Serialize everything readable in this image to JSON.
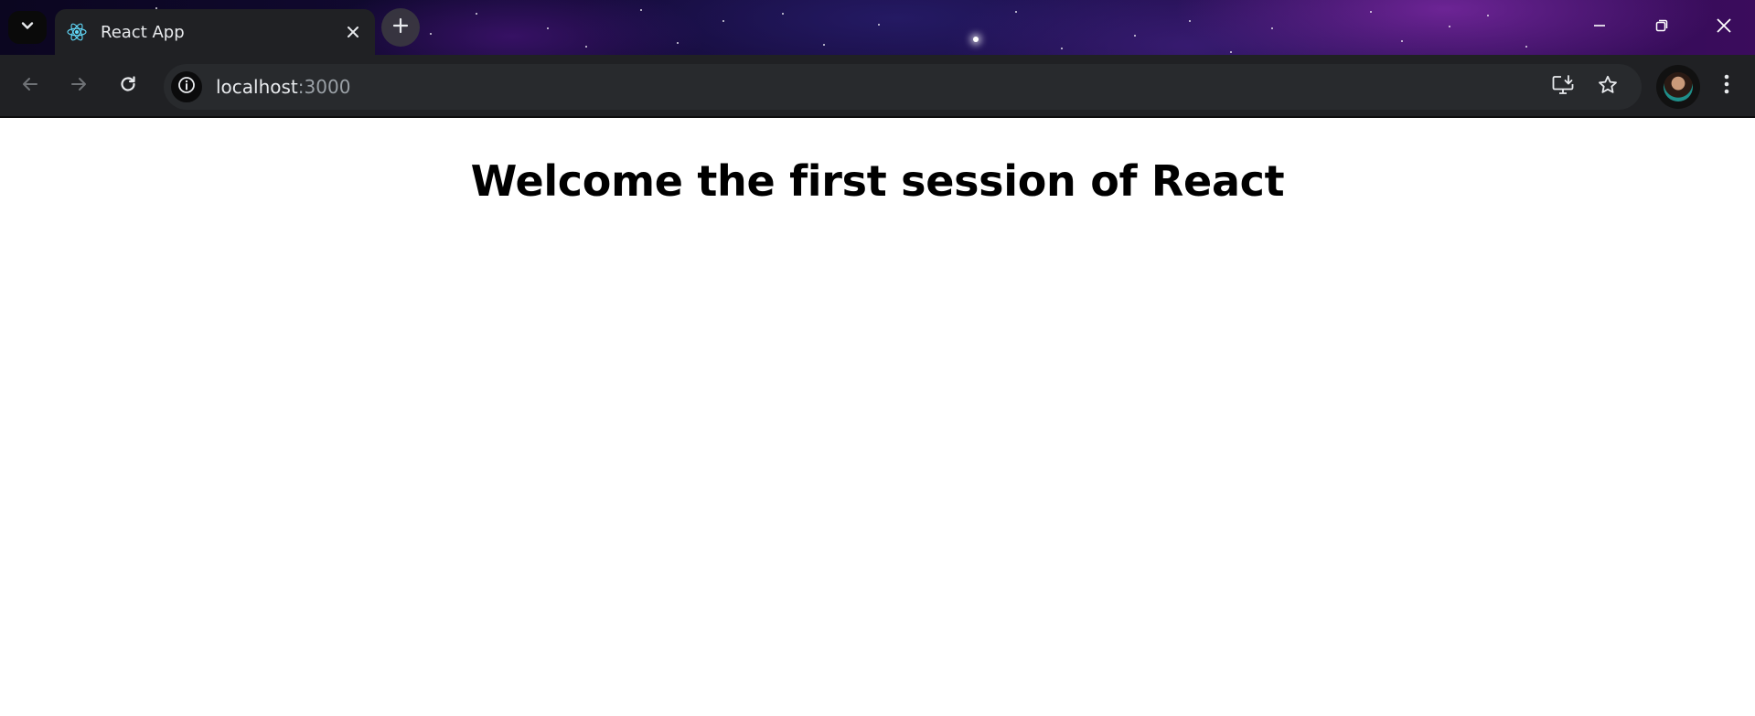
{
  "browser": {
    "tab": {
      "title": "React App",
      "favicon": "react-logo-icon"
    },
    "address_bar": {
      "host": "localhost",
      "port": ":3000"
    },
    "icons": {
      "tab_search": "chevron-down-icon",
      "tab_close": "close-icon",
      "new_tab": "plus-icon",
      "back": "arrow-left-icon",
      "forward": "arrow-right-icon",
      "reload": "reload-icon",
      "site_info": "info-icon",
      "install_app": "install-app-icon",
      "bookmark": "star-icon",
      "profile": "avatar",
      "menu": "more-vert-icon",
      "minimize": "minimize-icon",
      "restore": "restore-icon",
      "close_window": "close-icon"
    },
    "colors": {
      "toolbar": "#202124",
      "omnibox": "#282a2d",
      "accent": "#61dafb"
    }
  },
  "page": {
    "heading": "Welcome the first session of React"
  }
}
